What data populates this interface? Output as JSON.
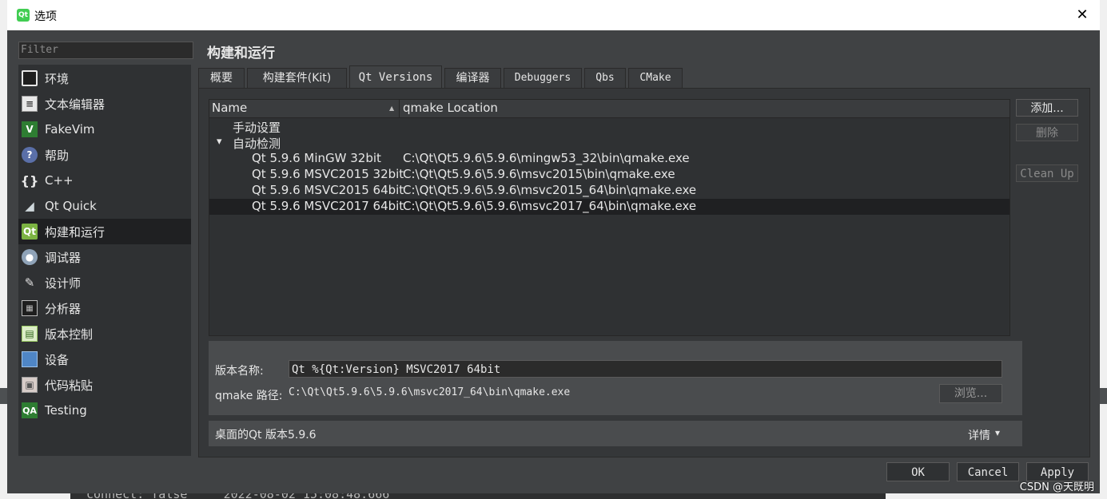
{
  "window": {
    "title": "选项",
    "close_glyph": "✕"
  },
  "background": {
    "console_text": "connect: false    \"2022-08-02 15:08:48.666\""
  },
  "filter": {
    "placeholder": "Filter"
  },
  "sidebar": {
    "items": [
      {
        "label": "环境",
        "icon": "monitor-icon"
      },
      {
        "label": "文本编辑器",
        "icon": "text-editor-icon"
      },
      {
        "label": "FakeVim",
        "icon": "fakevim-icon"
      },
      {
        "label": "帮助",
        "icon": "help-icon"
      },
      {
        "label": "C++",
        "icon": "cpp-braces-icon"
      },
      {
        "label": "Qt Quick",
        "icon": "qt-quick-icon"
      },
      {
        "label": "构建和运行",
        "icon": "build-run-icon",
        "selected": true
      },
      {
        "label": "调试器",
        "icon": "debugger-icon"
      },
      {
        "label": "设计师",
        "icon": "designer-icon"
      },
      {
        "label": "分析器",
        "icon": "analyzer-icon"
      },
      {
        "label": "版本控制",
        "icon": "version-control-icon"
      },
      {
        "label": "设备",
        "icon": "device-icon"
      },
      {
        "label": "代码粘贴",
        "icon": "code-paste-icon"
      },
      {
        "label": "Testing",
        "icon": "qa-testing-icon"
      }
    ]
  },
  "page": {
    "title": "构建和运行"
  },
  "tabs": [
    "概要",
    "构建套件(Kit)",
    "Qt Versions",
    "编译器",
    "Debuggers",
    "Qbs",
    "CMake"
  ],
  "active_tab": "Qt Versions",
  "tree": {
    "columns": [
      "Name",
      "qmake Location"
    ],
    "sort_indicator": "▲",
    "groups": [
      {
        "label": "手动设置",
        "expanded": false
      },
      {
        "label": "自动检测",
        "expanded": true
      }
    ],
    "rows": [
      {
        "name": "Qt 5.9.6 MinGW 32bit",
        "location": "C:\\Qt\\Qt5.9.6\\5.9.6\\mingw53_32\\bin\\qmake.exe"
      },
      {
        "name": "Qt 5.9.6 MSVC2015 32bit",
        "location": "C:\\Qt\\Qt5.9.6\\5.9.6\\msvc2015\\bin\\qmake.exe"
      },
      {
        "name": "Qt 5.9.6 MSVC2015 64bit",
        "location": "C:\\Qt\\Qt5.9.6\\5.9.6\\msvc2015_64\\bin\\qmake.exe"
      },
      {
        "name": "Qt 5.9.6 MSVC2017 64bit",
        "location": "C:\\Qt\\Qt5.9.6\\5.9.6\\msvc2017_64\\bin\\qmake.exe",
        "selected": true
      }
    ],
    "expand_glyph": "▾"
  },
  "side_buttons": {
    "add": "添加...",
    "remove": "删除",
    "cleanup": "Clean Up"
  },
  "details": {
    "name_label": "版本名称:",
    "name_value": "Qt %{Qt:Version} MSVC2017 64bit",
    "qmake_label": "qmake 路径:",
    "qmake_value": "C:\\Qt\\Qt5.9.6\\5.9.6\\msvc2017_64\\bin\\qmake.exe",
    "browse": "浏览..."
  },
  "info_bar": {
    "text": "桌面的Qt 版本5.9.6",
    "details": "详情",
    "details_glyph": "▾"
  },
  "footer": {
    "ok": "OK",
    "cancel": "Cancel",
    "apply": "Apply"
  },
  "watermark": "CSDN @天既明",
  "colors": {
    "dialog_bg": "#404244",
    "selection": "#1f2022",
    "text": "#e6e6e6"
  }
}
